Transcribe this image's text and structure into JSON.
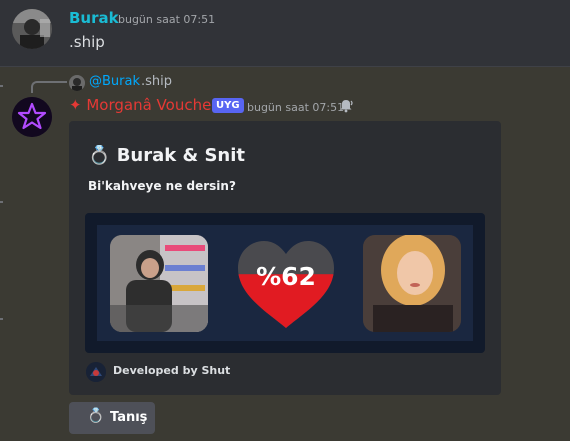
{
  "message1": {
    "username": "Burak",
    "timestamp": "bugün saat 07:51",
    "text": ".ship",
    "username_color": "#1abcd4"
  },
  "message2": {
    "reply": {
      "username": "@Burak",
      "text": ".ship"
    },
    "bot_name": "✦ Morganâ Voucher",
    "bot_name_color": "#e53935",
    "app_tag": "UYG",
    "timestamp": "bugün saat 07:51",
    "embed": {
      "title_emoji": "💍",
      "title": "Burak & Snit",
      "description": "Bi'kahveye ne dersin?",
      "percent": "%62",
      "percent_value": 62,
      "footer": "Developed by Shut"
    },
    "button": {
      "emoji": "💍",
      "label": "Tanış"
    }
  },
  "colors": {
    "background": "#313338",
    "highlight": "#3b3a33",
    "embed_bg": "#2b2d31",
    "heart_red": "#e11b22",
    "heart_gray": "#4a4a4e",
    "tag_blue": "#5865f2"
  },
  "icons": {
    "reply_avatar": "user-avatar-icon",
    "bot_avatar": "purple-star-icon",
    "notification": "bell-wave-icon",
    "heart": "heart-icon",
    "ring": "ring-icon"
  }
}
